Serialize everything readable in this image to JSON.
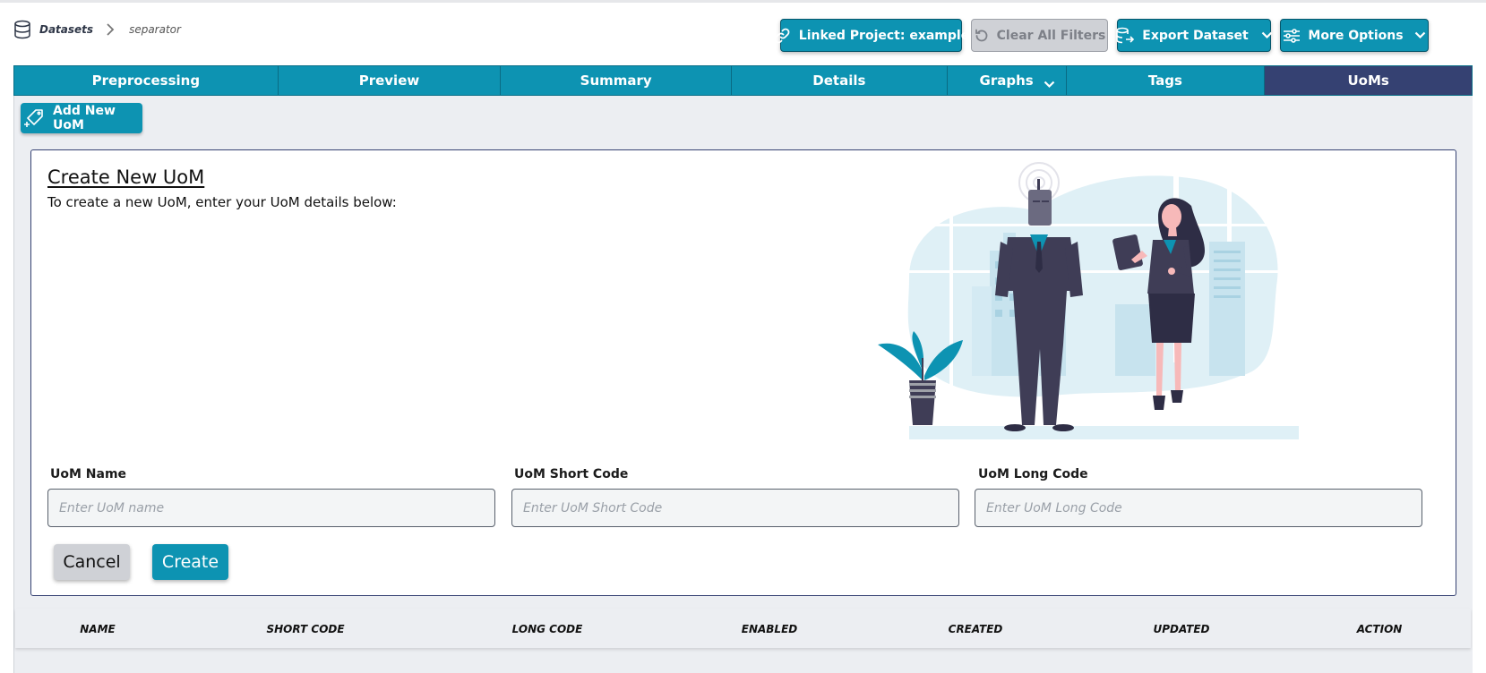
{
  "breadcrumb": {
    "root": "Datasets",
    "current": "separator"
  },
  "header": {
    "linked_project": "Linked Project: example",
    "clear_filters": "Clear All Filters",
    "export_dataset": "Export Dataset",
    "more_options": "More Options"
  },
  "tabs": [
    {
      "label": "Preprocessing"
    },
    {
      "label": "Preview"
    },
    {
      "label": "Summary"
    },
    {
      "label": "Details"
    },
    {
      "label": "Graphs"
    },
    {
      "label": "Tags"
    },
    {
      "label": "UoMs",
      "active": true
    }
  ],
  "add_button": "Add New UoM",
  "form": {
    "title": "Create New UoM",
    "subtitle": "To create a new UoM, enter your UoM details below:",
    "name_label": "UoM Name",
    "name_placeholder": "Enter UoM name",
    "short_label": "UoM Short Code",
    "short_placeholder": "Enter UoM Short Code",
    "long_label": "UoM Long Code",
    "long_placeholder": "Enter UoM Long Code",
    "cancel": "Cancel",
    "create": "Create"
  },
  "table": {
    "columns": [
      "NAME",
      "SHORT CODE",
      "LONG CODE",
      "ENABLED",
      "CREATED",
      "UPDATED",
      "ACTION"
    ]
  },
  "colors": {
    "primary": "#0d93b2",
    "active_tab": "#354172",
    "disabled": "#cfd1d6",
    "background": "#eceef2"
  },
  "icons": {
    "breadcrumb": "database-icon",
    "linked_project": "link-icon",
    "clear_filters": "reset-icon",
    "export_dataset": "database-export-icon",
    "more_options": "sliders-icon",
    "add_uom": "tag-plus-icon"
  }
}
